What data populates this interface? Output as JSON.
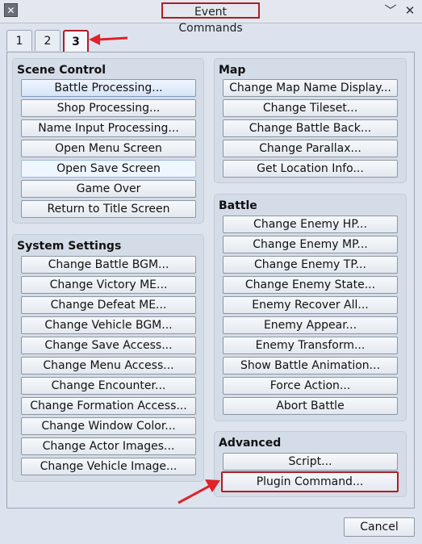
{
  "window": {
    "title": "Event Commands",
    "icon": "app-x-icon",
    "minimize_glyph": "﹀",
    "close_glyph": "✕"
  },
  "tabs": [
    {
      "label": "1",
      "active": false
    },
    {
      "label": "2",
      "active": false
    },
    {
      "label": "3",
      "active": true
    }
  ],
  "scene_control": {
    "title": "Scene Control",
    "buttons": [
      "Battle Processing...",
      "Shop Processing...",
      "Name Input Processing...",
      "Open Menu Screen",
      "Open Save Screen",
      "Game Over",
      "Return to Title Screen"
    ]
  },
  "system_settings": {
    "title": "System Settings",
    "buttons": [
      "Change Battle BGM...",
      "Change Victory ME...",
      "Change Defeat ME...",
      "Change Vehicle BGM...",
      "Change Save Access...",
      "Change Menu Access...",
      "Change Encounter...",
      "Change Formation Access...",
      "Change Window Color...",
      "Change Actor Images...",
      "Change Vehicle Image..."
    ]
  },
  "map": {
    "title": "Map",
    "buttons": [
      "Change Map Name Display...",
      "Change Tileset...",
      "Change Battle Back...",
      "Change Parallax...",
      "Get Location Info..."
    ]
  },
  "battle": {
    "title": "Battle",
    "buttons": [
      "Change Enemy HP...",
      "Change Enemy MP...",
      "Change Enemy TP...",
      "Change Enemy State...",
      "Enemy Recover All...",
      "Enemy Appear...",
      "Enemy Transform...",
      "Show Battle Animation...",
      "Force Action...",
      "Abort Battle"
    ]
  },
  "advanced": {
    "title": "Advanced",
    "buttons": [
      "Script...",
      "Plugin Command..."
    ]
  },
  "footer": {
    "cancel_label": "Cancel"
  },
  "annotation_color": "#b01c24"
}
